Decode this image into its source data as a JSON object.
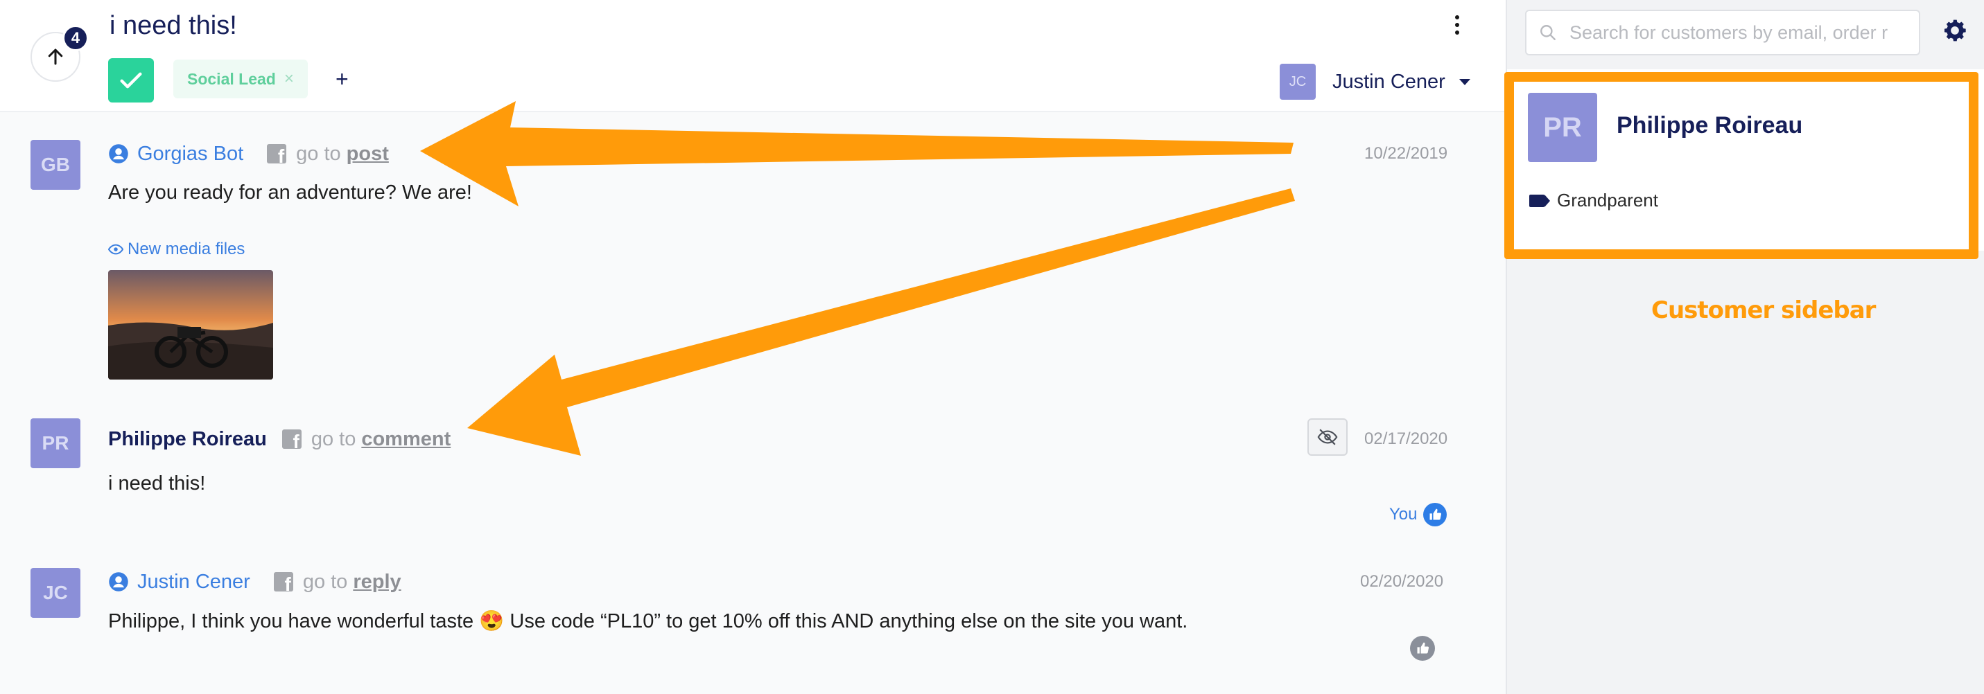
{
  "header": {
    "title": "i need this!",
    "unread_count": "4",
    "tag": "Social Lead",
    "tag_remove": "×",
    "add_tag": "+",
    "assignee_initials": "JC",
    "assignee_name": "Justin Cener"
  },
  "messages": [
    {
      "initials": "GB",
      "author": "Gorgias Bot",
      "goto_prefix": "go to",
      "goto_link": "post",
      "date": "10/22/2019",
      "body": "Are you ready for an adventure? We are!",
      "media_label": "New media files"
    },
    {
      "initials": "PR",
      "author": "Philippe Roireau",
      "goto_prefix": "go to",
      "goto_link": "comment",
      "date": "02/17/2020",
      "body": "i need this!",
      "reaction_label": "You"
    },
    {
      "initials": "JC",
      "author": "Justin Cener",
      "goto_prefix": "go to",
      "goto_link": "reply",
      "date": "02/20/2020",
      "body": "Philippe, I think you have wonderful taste 😍  Use code “PL10” to get 10% off this AND anything else on the site you want."
    }
  ],
  "sidebar": {
    "search_placeholder": "Search for customers by email, order r",
    "customer_initials": "PR",
    "customer_name": "Philippe Roireau",
    "customer_tag": "Grandparent",
    "caption": "Customer sidebar"
  },
  "colors": {
    "accent": "#3a7ee0",
    "navy": "#161f59",
    "success": "#2ad39b",
    "annotation": "#ff9b0a",
    "avatar": "#8b8fd8"
  }
}
